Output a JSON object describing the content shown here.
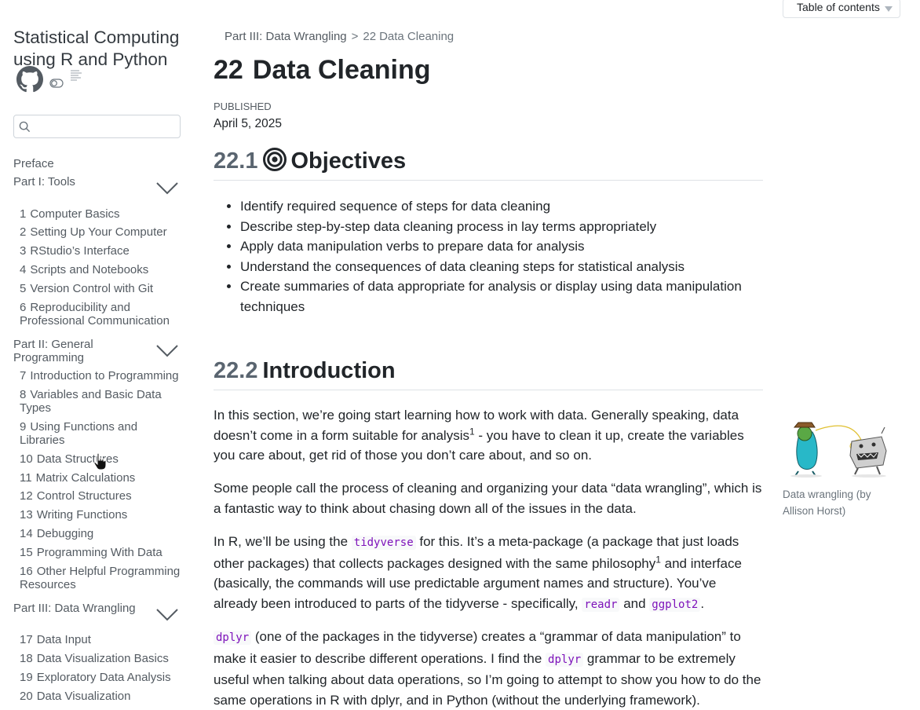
{
  "sidebar": {
    "site_title": "Statistical Computing using R and Python",
    "search": {
      "value": "",
      "placeholder": ""
    },
    "preface": "Preface",
    "parts": [
      {
        "label": "Part I: Tools"
      },
      {
        "label": "Part II: General Programming"
      },
      {
        "label": "Part III: Data Wrangling"
      }
    ],
    "items": [
      {
        "num": "1",
        "label": "Computer Basics"
      },
      {
        "num": "2",
        "label": "Setting Up Your Computer"
      },
      {
        "num": "3",
        "label": "RStudio’s Interface"
      },
      {
        "num": "4",
        "label": "Scripts and Notebooks"
      },
      {
        "num": "5",
        "label": "Version Control with Git"
      },
      {
        "num": "6",
        "label": "Reproducibility and Professional Communication"
      },
      {
        "num": "7",
        "label": "Introduction to Programming"
      },
      {
        "num": "8",
        "label": "Variables and Basic Data Types"
      },
      {
        "num": "9",
        "label": "Using Functions and Libraries"
      },
      {
        "num": "10",
        "label": "Data Structures"
      },
      {
        "num": "11",
        "label": "Matrix Calculations"
      },
      {
        "num": "12",
        "label": "Control Structures"
      },
      {
        "num": "13",
        "label": "Writing Functions"
      },
      {
        "num": "14",
        "label": "Debugging"
      },
      {
        "num": "15",
        "label": "Programming With Data"
      },
      {
        "num": "16",
        "label": "Other Helpful Programming Resources"
      },
      {
        "num": "17",
        "label": "Data Input"
      },
      {
        "num": "18",
        "label": "Data Visualization Basics"
      },
      {
        "num": "19",
        "label": "Exploratory Data Analysis"
      },
      {
        "num": "20",
        "label": "Data Visualization"
      }
    ]
  },
  "breadcrumb": {
    "part": "Part III: Data Wrangling",
    "separator": ">",
    "current_num": "22",
    "current_label": "Data Cleaning"
  },
  "chapter": {
    "num": "22",
    "title": "Data Cleaning",
    "published_label": "Published",
    "published_date": "April 5, 2025"
  },
  "sections": [
    {
      "num": "22.1",
      "title": "Objectives"
    },
    {
      "num": "22.2",
      "title": "Introduction"
    }
  ],
  "objectives": [
    "Identify required sequence of steps for data cleaning",
    "Describe step-by-step data cleaning process in lay terms appropriately",
    "Apply data manipulation verbs to prepare data for analysis",
    "Understand the consequences of data cleaning steps for statistical analysis",
    "Create summaries of data appropriate for analysis or display using data manipulation techniques"
  ],
  "intro": {
    "p1": {
      "a": "In this section, we’re going start learning how to work with data. Generally speaking, data doesn’t come in a form suitable for analysis",
      "sup": "1",
      "b": " - you have to clean it up, create the variables you care about, get rid of those you don’t care about, and so on."
    },
    "p2": "Some people call the process of cleaning and organizing your data “data wrangling”, which is a fantastic way to think about chasing down all of the issues in the data.",
    "p3": {
      "a": "In R, we’ll be using the ",
      "code1": "tidyverse",
      "b": " for this. It’s a meta-package (a package that just loads other packages) that collects packages designed with the same philosophy",
      "sup": "1",
      "c": " and interface (basically, the commands will use predictable argument names and structure). You’ve already been introduced to parts of the tidyverse - specifically, ",
      "code2": "readr",
      "d": " and ",
      "code3": "ggplot2",
      "e": "."
    },
    "p4": {
      "code1": "dplyr",
      "a": " (one of the packages in the tidyverse) creates a “grammar of data manipulation” to make it easier to describe different operations. I find the ",
      "code2": "dplyr",
      "b": " grammar to be extremely useful when talking about data operations, so I’m going to attempt to show you how to do the same operations in R with dplyr, and in Python (without the underlying framework)."
    }
  },
  "toc": {
    "label": "Table of contents"
  },
  "figure": {
    "caption": "Data wrangling (by Allison Horst)"
  },
  "icons": {
    "github": "github-icon",
    "toggle": "dark-mode-toggle-icon",
    "reader": "reader-mode-icon",
    "search": "search-icon",
    "chevron": "chevron-down-icon",
    "target": "target-icon",
    "cursor": "hand-cursor-icon"
  },
  "colors": {
    "link": "#545b62",
    "code": "#7d12ba",
    "section_number": "#5a6570",
    "border": "#dee2e6"
  }
}
